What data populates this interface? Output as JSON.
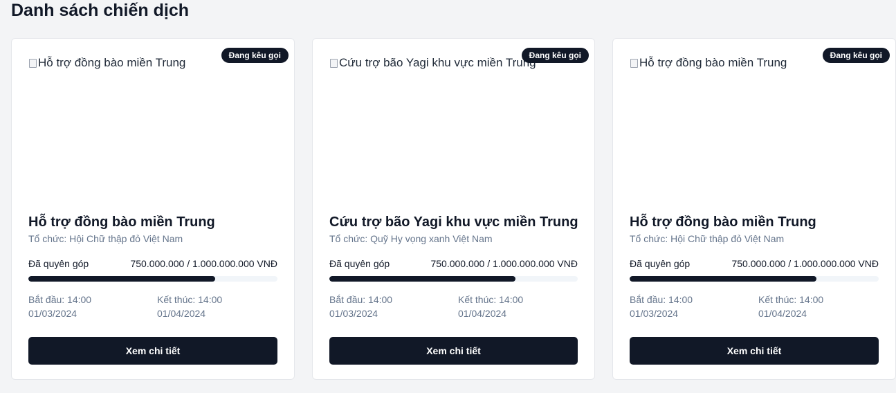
{
  "page": {
    "title": "Danh sách chiến dịch"
  },
  "labels": {
    "raised": "Đã quyên góp",
    "start_prefix": "Bắt đầu:",
    "end_prefix": "Kết thúc:",
    "detail_button": "Xem chi tiết"
  },
  "colors": {
    "primary": "#111827",
    "track": "#f1f5f9",
    "muted_text": "#64748b",
    "background": "#f3f4f6"
  },
  "campaigns": [
    {
      "image_alt": "Hỗ trợ đồng bào miền Trung",
      "status": "Đang kêu gọi",
      "title": "Hỗ trợ đồng bào miền Trung",
      "organization": "Tổ chức: Hội Chữ thập đỏ Việt Nam",
      "raised_label": "Đã quyên góp",
      "raised_amount": "750.000.000 / 1.000.000.000 VNĐ",
      "progress": 0.75,
      "start_time": "Bắt đầu: 14:00",
      "start_date": "01/03/2024",
      "end_time": "Kết thúc: 14:00",
      "end_date": "01/04/2024",
      "button": "Xem chi tiết"
    },
    {
      "image_alt": "Cứu trợ bão Yagi khu vực miền Trung",
      "status": "Đang kêu gọi",
      "title": "Cứu trợ bão Yagi khu vực miền Trung",
      "organization": "Tổ chức: Quỹ Hy vọng xanh Việt Nam",
      "raised_label": "Đã quyên góp",
      "raised_amount": "750.000.000 / 1.000.000.000 VNĐ",
      "progress": 0.75,
      "start_time": "Bắt đầu: 14:00",
      "start_date": "01/03/2024",
      "end_time": "Kết thúc: 14:00",
      "end_date": "01/04/2024",
      "button": "Xem chi tiết"
    },
    {
      "image_alt": "Hỗ trợ đồng bào miền Trung",
      "status": "Đang kêu gọi",
      "title": "Hỗ trợ đồng bào miền Trung",
      "organization": "Tổ chức: Hội Chữ thập đỏ Việt Nam",
      "raised_label": "Đã quyên góp",
      "raised_amount": "750.000.000 / 1.000.000.000 VNĐ",
      "progress": 0.75,
      "start_time": "Bắt đầu: 14:00",
      "start_date": "01/03/2024",
      "end_time": "Kết thúc: 14:00",
      "end_date": "01/04/2024",
      "button": "Xem chi tiết"
    }
  ]
}
